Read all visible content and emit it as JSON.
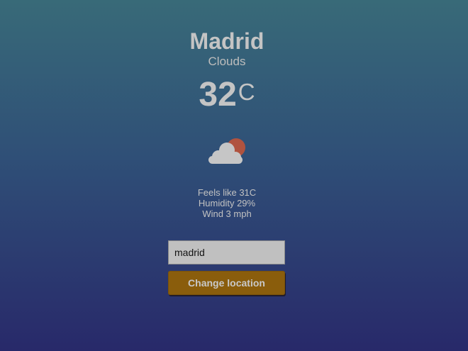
{
  "weather": {
    "city": "Madrid",
    "condition": "Clouds",
    "temperature": "32",
    "unit": "C",
    "icon": "cloud-sun-icon",
    "feels_like": "Feels like 31C",
    "humidity": "Humidity 29%",
    "wind": "Wind 3 mph"
  },
  "form": {
    "location_value": "madrid",
    "button_label": "Change location"
  },
  "colors": {
    "background_top": "#386a78",
    "background_bottom": "#28296a",
    "button": "#8a5d0c",
    "sun": "#b0533f",
    "cloud": "#c6c6c6"
  }
}
